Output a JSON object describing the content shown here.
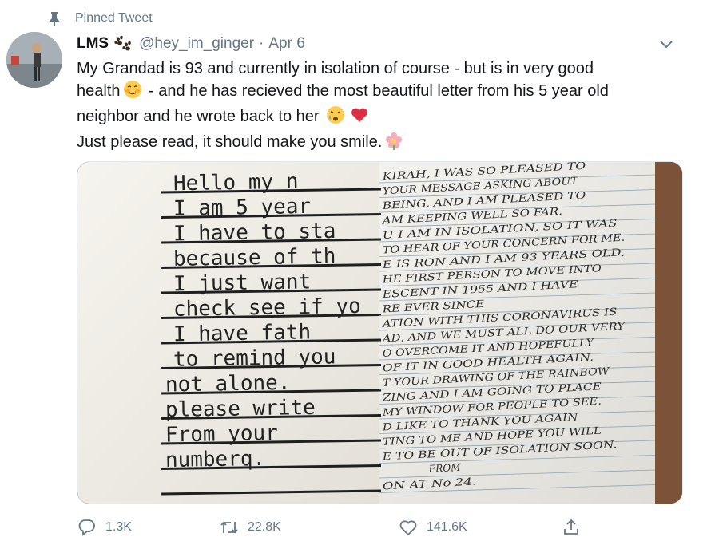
{
  "pinned": {
    "label": "Pinned Tweet",
    "icon": "pin-icon"
  },
  "author": {
    "name": "LMS",
    "badge_icon": "paw-prints-icon",
    "handle": "@hey_im_ginger",
    "separator": "·",
    "date": "Apr 6"
  },
  "tweet": {
    "line1": "My Grandad is 93 and currently in isolation of course - but is in very good",
    "line2a": "health",
    "line2b": " - and he has recieved the most beautiful letter from his 5 year old",
    "line3": "neighbor and he wrote back to her",
    "line4": "Just please read, it should make you smile.",
    "emojis": [
      "smiling-face-icon",
      "crying-face-icon",
      "red-heart-icon",
      "blossom-icon"
    ]
  },
  "media": {
    "left_letter": [
      "Hello my n",
      "I am 5 year",
      "I have to sta",
      "because of th",
      "I just want",
      "check see if yo",
      "I have fath",
      "to remind you",
      "not alone.",
      "please write",
      "From your",
      "numberq."
    ],
    "right_letter": [
      "KIRAH, I WAS SO PLEASED TO",
      "YOUR MESSAGE ASKING ABOUT",
      "BEING, AND I AM PLEASED TO",
      "AM KEEPING WELL SO FAR.",
      "U I AM IN ISOLATION, SO IT WAS",
      "TO HEAR OF YOUR CONCERN FOR ME.",
      "E IS RON AND I AM 93 YEARS OLD,",
      "HE FIRST PERSON TO MOVE INTO",
      "ESCENT IN 1955 AND I HAVE",
      "RE EVER SINCE",
      "ATION WITH THIS CORONAVIRUS IS",
      "AD, AND WE MUST ALL DO OUR VERY",
      "O OVERCOME IT AND HOPEFULLY",
      "OF IT IN GOOD HEALTH AGAIN.",
      "T YOUR DRAWING OF THE RAINBOW",
      "ZING AND I AM GOING TO PLACE",
      "MY WINDOW FOR PEOPLE TO SEE.",
      "D LIKE TO THANK YOU AGAIN",
      "TING TO ME AND HOPE YOU WILL",
      "E TO BE OUT OF ISOLATION SOON.",
      "FROM",
      "ON AT No 24."
    ]
  },
  "actions": {
    "reply": {
      "icon": "reply-icon",
      "count": "1.3K"
    },
    "retweet": {
      "icon": "retweet-icon",
      "count": "22.8K"
    },
    "like": {
      "icon": "heart-icon",
      "count": "141.6K"
    },
    "share": {
      "icon": "share-icon"
    }
  },
  "colors": {
    "secondary_text": "#657786",
    "primary_text": "#14171a",
    "heart": "#e0245e"
  }
}
